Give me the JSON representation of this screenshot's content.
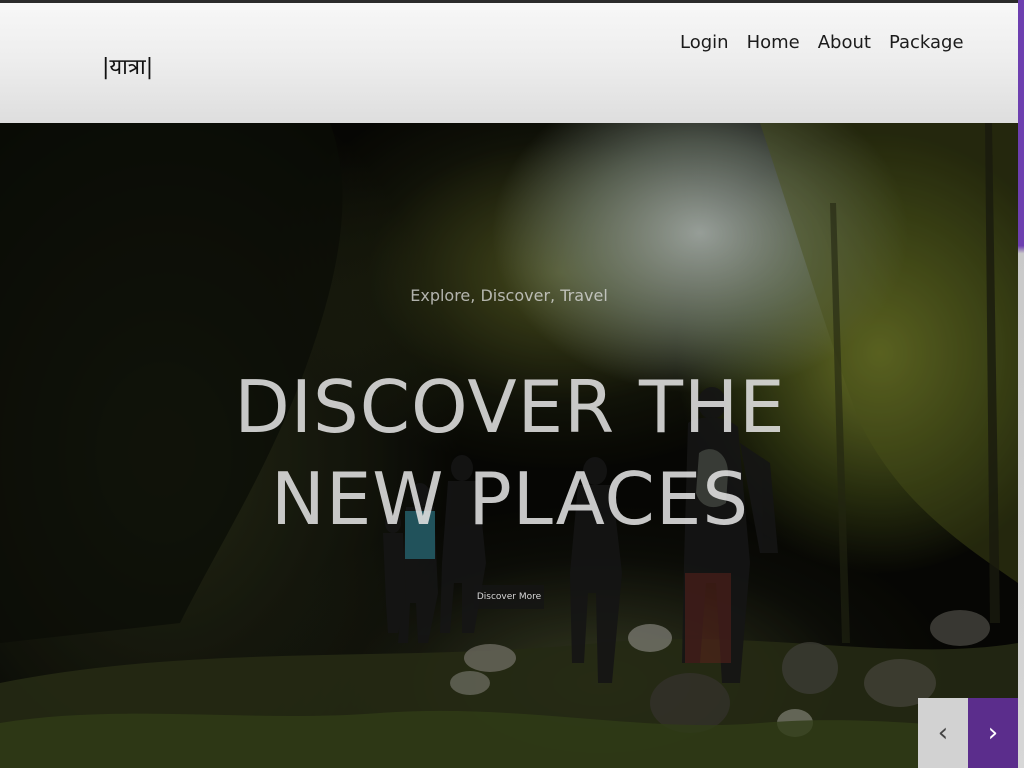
{
  "header": {
    "logo_text": "|यात्रा|",
    "nav": [
      {
        "label": "Login"
      },
      {
        "label": "Home"
      },
      {
        "label": "About"
      },
      {
        "label": "Package"
      }
    ]
  },
  "hero": {
    "subtitle": "Explore, Discover, Travel",
    "title": "DISCOVER THE NEW PLACES",
    "cta_label": "Discover More"
  },
  "slider": {
    "prev_icon": "‹",
    "next_icon": "›",
    "prev_icon_name": "chevron-left-icon",
    "next_icon_name": "chevron-right-icon"
  },
  "colors": {
    "accent": "#5b2d8c",
    "header_bg": "#eeeeee",
    "strip": "#6d3fb0"
  }
}
